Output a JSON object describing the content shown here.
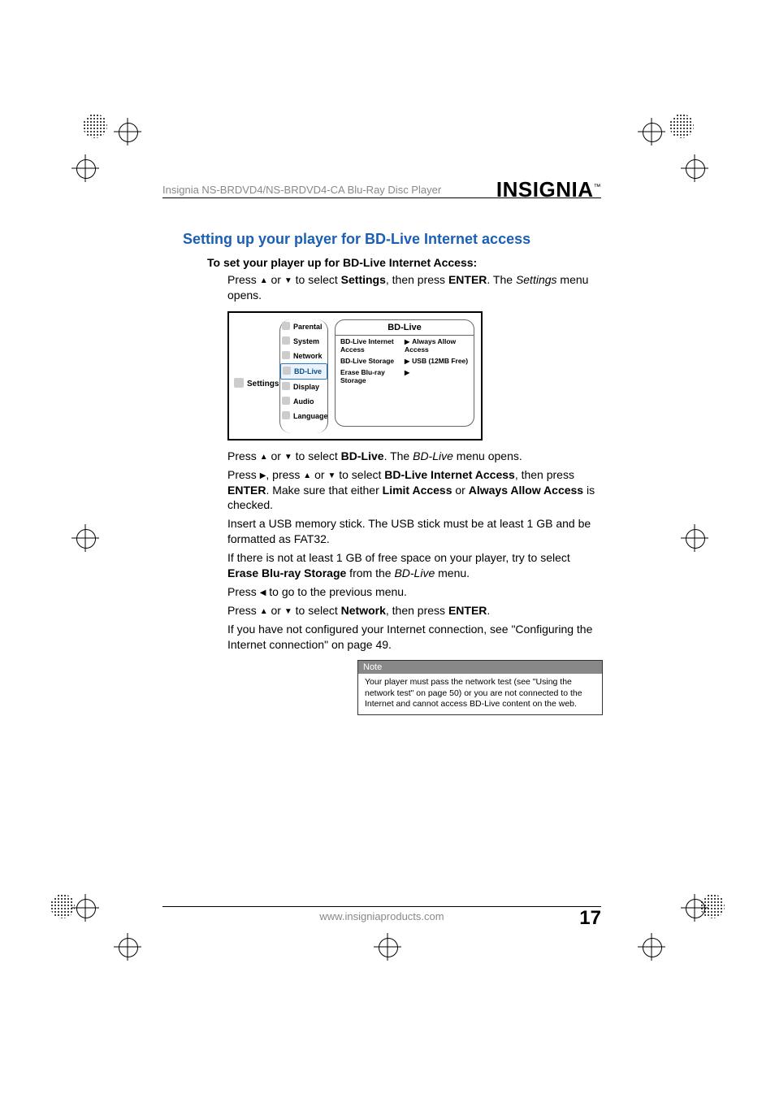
{
  "header": {
    "product_line": "Insignia NS-BRDVD4/NS-BRDVD4-CA Blu-Ray Disc Player",
    "logo_text": "INSIGNIA",
    "logo_tm": "™"
  },
  "section_title": "Setting up your player for BD-Live Internet access",
  "subhead": "To set your player up for BD-Live Internet Access:",
  "steps": {
    "s1_a": "Press ",
    "s1_b": " or ",
    "s1_c": " to select ",
    "s1_settings": "Settings",
    "s1_d": ", then press ",
    "s1_enter": "ENTER",
    "s1_e": ". The ",
    "s1_settings_i": "Settings",
    "s1_f": " menu opens.",
    "s2_a": "Press ",
    "s2_b": " or ",
    "s2_c": " to select ",
    "s2_bdlive": "BD-Live",
    "s2_d": ". The ",
    "s2_bdlive_i": "BD-Live",
    "s2_e": " menu opens.",
    "s3_a": "Press ",
    "s3_b": ", press ",
    "s3_c": " or ",
    "s3_d": " to select ",
    "s3_access": "BD-Live Internet Access",
    "s3_e": ", then press ",
    "s3_enter": "ENTER",
    "s3_f": ". Make sure that either ",
    "s3_limit": "Limit Access",
    "s3_g": " or ",
    "s3_always": "Always Allow Access",
    "s3_h": " is checked.",
    "s4": "Insert a USB memory stick. The USB stick must be at least 1 GB and be formatted as FAT32.",
    "s5_a": "If there is not at least 1 GB of free space on your player, try to select ",
    "s5_erase": "Erase Blu-ray Storage",
    "s5_b": " from the ",
    "s5_bdlive_i": "BD-Live",
    "s5_c": " menu.",
    "s6_a": "Press ",
    "s6_b": " to go to the previous menu.",
    "s7_a": "Press ",
    "s7_b": " or ",
    "s7_c": " to select ",
    "s7_net": "Network",
    "s7_d": ", then press ",
    "s7_enter": "ENTER",
    "s7_e": ".",
    "s8": "If you have not configured your Internet connection, see \"Configuring the Internet connection\" on page 49."
  },
  "screenshot": {
    "left_category": "Settings",
    "sidebar": {
      "parental": "Parental",
      "system": "System",
      "network": "Network",
      "bdlive": "BD-Live",
      "display": "Display",
      "audio": "Audio",
      "language": "Language"
    },
    "panel_title": "BD-Live",
    "rows": {
      "r1k": "BD-Live Internet Access",
      "r1v": "Always Allow Access",
      "r2k": "BD-Live Storage",
      "r2v": "USB (12MB Free)",
      "r3k": "Erase Blu-ray Storage",
      "r3v": ""
    }
  },
  "note": {
    "head": "Note",
    "body": "Your player must pass the network test (see \"Using the network test\" on page 50) or you are not connected to the Internet and cannot access BD-Live content on the web."
  },
  "footer": {
    "url": "www.insigniaproducts.com",
    "page": "17"
  }
}
